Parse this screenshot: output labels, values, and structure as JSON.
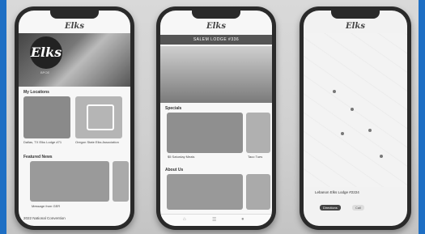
{
  "phone1": {
    "logo": "Elks",
    "hero_logo": "Elks",
    "hero_sub": "BPOE",
    "my_locations_title": "My Locations",
    "location1_caption": "Dallas, TX Elks Lodge #71",
    "location2_caption": "Oregon State Elks Association",
    "featured_news_title": "Featured News",
    "news_caption": "Message from GER",
    "footer_text": "2022 National Convention"
  },
  "phone2": {
    "logo": "Elks",
    "lodge_title": "SALEM LODGE #336",
    "specials_title": "Specials",
    "special_caption": "$5 Saturday Meals",
    "special_caption2": "Taco Tues",
    "about_title": "About Us"
  },
  "phone3": {
    "logo": "Elks",
    "place_title": "Lebanon Elks Lodge #2224",
    "directions_label": "Directions",
    "call_label": "Call"
  },
  "colors": {
    "border_blue": "#1e6fc4"
  }
}
